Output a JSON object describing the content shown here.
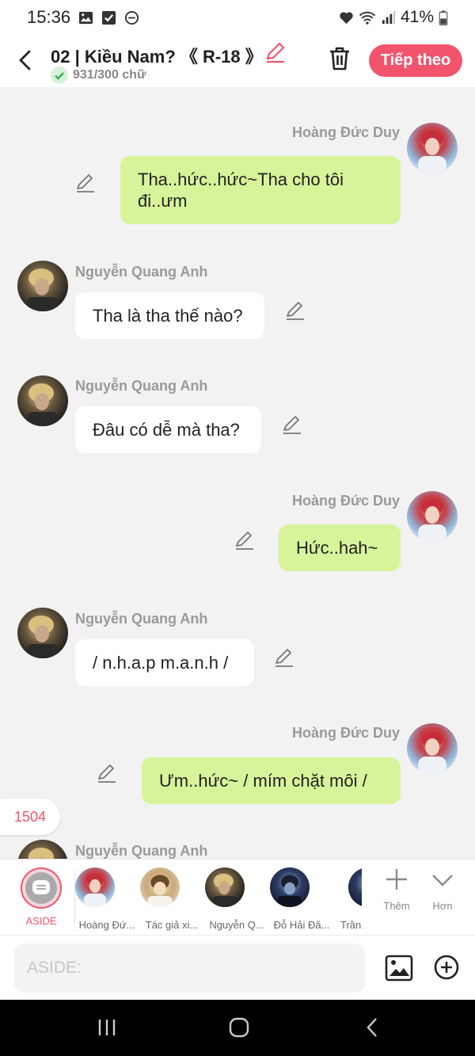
{
  "status": {
    "time": "15:36",
    "battery": "41%",
    "icons": [
      "image-icon",
      "check-square-icon",
      "dnd-icon",
      "heart-icon",
      "wifi-icon",
      "signal-icon",
      "battery-icon"
    ]
  },
  "header": {
    "title": "02 | Kiều Nam? 《 R-18 》",
    "word_count": "931/300 chữ",
    "next_label": "Tiếp theo"
  },
  "messages": [
    {
      "side": "right",
      "name": "Hoàng Đức Duy",
      "text_lines": [
        "Tha..hức..hức~Tha cho tôi",
        "đi..ưm"
      ]
    },
    {
      "side": "left",
      "name": "Nguyễn Quang Anh",
      "text": "Tha là tha thế nào?"
    },
    {
      "side": "left",
      "name": "Nguyễn Quang Anh",
      "text": "Đâu có dễ mà tha?"
    },
    {
      "side": "right",
      "name": "Hoàng Đức Duy",
      "text": "Hức..hah~"
    },
    {
      "side": "left",
      "name": "Nguyễn Quang Anh",
      "text": "/ n.h.a.p m.a.n.h /"
    },
    {
      "side": "right",
      "name": "Hoàng Đức Duy",
      "text": "Ưm..hức~ / mím chặt môi /"
    },
    {
      "side": "left",
      "name": "Nguyễn Quang Anh"
    }
  ],
  "counter": "1504",
  "charbar": {
    "aside_label": "ASIDE",
    "characters": [
      "Hoàng Đứ...",
      "Tác giả xi...",
      "Nguyễn Q...",
      "Đỗ Hải Đă...",
      "Trần"
    ],
    "add_label": "Thêm",
    "more_label": "Hơn"
  },
  "input": {
    "placeholder": "ASIDE:"
  },
  "colors": {
    "accent": "#f2546e",
    "my_bubble": "#d8f49a",
    "other_bubble": "#ffffff",
    "background": "#f2f2f2"
  }
}
